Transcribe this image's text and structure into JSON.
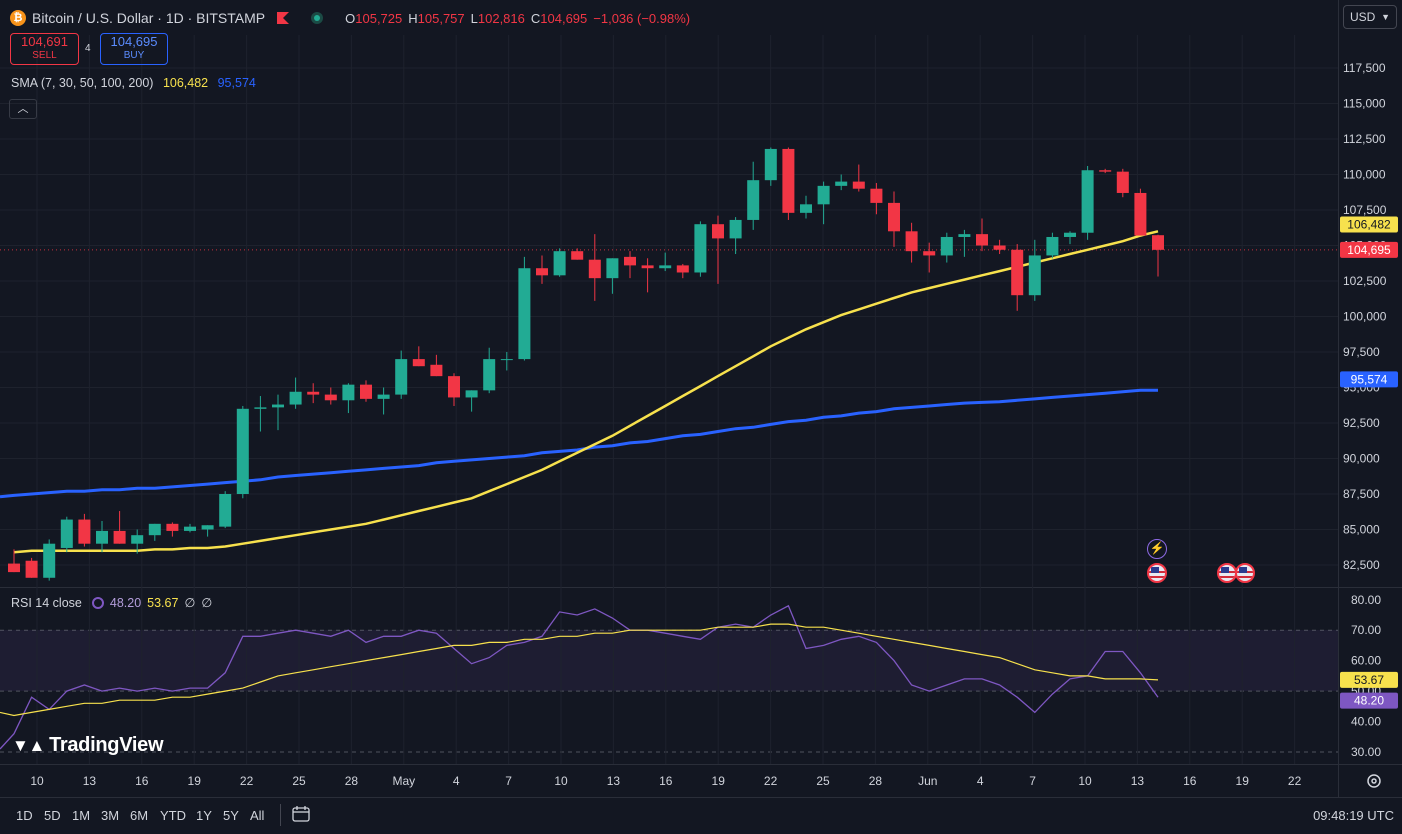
{
  "header": {
    "coin_symbol": "₿",
    "title": "Bitcoin / U.S. Dollar · 1D · BITSTAMP",
    "ohlc": [
      {
        "k": "O",
        "v": "105,725"
      },
      {
        "k": "H",
        "v": "105,757"
      },
      {
        "k": "L",
        "v": "102,816"
      },
      {
        "k": "C",
        "v": "104,695"
      },
      {
        "k": "",
        "v": "−1,036 (−0.98%)"
      }
    ]
  },
  "trade": {
    "sell_price": "104,691",
    "sell_label": "SELL",
    "spread": "4",
    "buy_price": "104,695",
    "buy_label": "BUY"
  },
  "sma": {
    "label": "SMA (7, 30, 50, 100, 200)",
    "v1": "106,482",
    "v2": "95,574"
  },
  "currency": "USD",
  "collapse_icon": "chevron-up-icon",
  "rsi_legend": {
    "label": "RSI 14 close",
    "v1": "48.20",
    "v2": "53.67",
    "v3": "∅",
    "v4": "∅"
  },
  "logo": "TradingView",
  "periods": [
    "1D",
    "5D",
    "1M",
    "3M",
    "6M",
    "YTD",
    "1Y",
    "5Y",
    "All"
  ],
  "clock": "09:48:19 UTC",
  "colors": {
    "up": "#22ab94",
    "down": "#f23645",
    "sma_fast": "#f7e14d",
    "sma_slow": "#2962ff",
    "rsi": "#7e57c2",
    "rsi_ma": "#f7e14d",
    "bg": "#131722"
  },
  "chart_data": [
    {
      "type": "candlestick",
      "x": [
        "Apr 9",
        "Apr 10",
        "Apr 11",
        "Apr 12",
        "Apr 13",
        "Apr 14",
        "Apr 15",
        "Apr 16",
        "Apr 17",
        "Apr 18",
        "Apr 19",
        "Apr 20",
        "Apr 21",
        "Apr 22",
        "Apr 23",
        "Apr 24",
        "Apr 25",
        "Apr 26",
        "Apr 27",
        "Apr 28",
        "Apr 29",
        "Apr 30",
        "May 1",
        "May 2",
        "May 3",
        "May 4",
        "May 5",
        "May 6",
        "May 7",
        "May 8",
        "May 9",
        "May 10",
        "May 11",
        "May 12",
        "May 13",
        "May 14",
        "May 15",
        "May 16",
        "May 17",
        "May 18",
        "May 19",
        "May 20",
        "May 21",
        "May 22",
        "May 23",
        "May 24",
        "May 25",
        "May 26",
        "May 27",
        "May 28",
        "May 29",
        "May 30",
        "May 31",
        "Jun 1",
        "Jun 2",
        "Jun 3",
        "Jun 4",
        "Jun 5",
        "Jun 6",
        "Jun 7",
        "Jun 8",
        "Jun 9",
        "Jun 10",
        "Jun 11",
        "Jun 12",
        "Jun 13"
      ],
      "ohlc": [
        [
          82600,
          83600,
          82000,
          82000
        ],
        [
          82800,
          83000,
          81600,
          81600
        ],
        [
          81600,
          84300,
          81400,
          84000
        ],
        [
          83700,
          85900,
          83400,
          85700
        ],
        [
          85700,
          86100,
          83800,
          84000
        ],
        [
          84000,
          85600,
          83400,
          84900
        ],
        [
          84900,
          86300,
          84000,
          84000
        ],
        [
          84000,
          85000,
          83300,
          84600
        ],
        [
          84600,
          85400,
          84200,
          85400
        ],
        [
          85400,
          85500,
          84500,
          84900
        ],
        [
          84900,
          85400,
          84800,
          85200
        ],
        [
          85000,
          85300,
          84500,
          85300
        ],
        [
          85200,
          87700,
          85100,
          87500
        ],
        [
          87500,
          93700,
          87200,
          93500
        ],
        [
          93500,
          94400,
          91900,
          93600
        ],
        [
          93600,
          94500,
          92000,
          93800
        ],
        [
          93800,
          95700,
          93500,
          94700
        ],
        [
          94700,
          95300,
          93900,
          94500
        ],
        [
          94500,
          95000,
          93800,
          94100
        ],
        [
          94100,
          95300,
          93200,
          95200
        ],
        [
          95200,
          95500,
          94000,
          94200
        ],
        [
          94200,
          95000,
          93100,
          94500
        ],
        [
          94500,
          97600,
          94200,
          97000
        ],
        [
          97000,
          97900,
          96500,
          96500
        ],
        [
          96600,
          97300,
          95800,
          95800
        ],
        [
          95800,
          96000,
          93700,
          94300
        ],
        [
          94300,
          94800,
          93300,
          94800
        ],
        [
          94800,
          97800,
          94600,
          97000
        ],
        [
          97000,
          97500,
          96200,
          97000
        ],
        [
          97000,
          104200,
          96900,
          103400
        ],
        [
          103400,
          104300,
          102300,
          102900
        ],
        [
          102900,
          104800,
          102800,
          104600
        ],
        [
          104600,
          104800,
          104000,
          104000
        ],
        [
          104000,
          105800,
          101100,
          102700
        ],
        [
          102700,
          104100,
          101600,
          104100
        ],
        [
          104200,
          104600,
          102700,
          103600
        ],
        [
          103600,
          104100,
          101700,
          103400
        ],
        [
          103400,
          104500,
          103200,
          103600
        ],
        [
          103600,
          103700,
          102700,
          103100
        ],
        [
          103100,
          106700,
          102800,
          106500
        ],
        [
          106500,
          107100,
          102300,
          105500
        ],
        [
          105500,
          107000,
          104400,
          106800
        ],
        [
          106800,
          110900,
          106100,
          109600
        ],
        [
          109600,
          111900,
          109200,
          111800
        ],
        [
          111800,
          111900,
          106800,
          107300
        ],
        [
          107300,
          108500,
          106900,
          107900
        ],
        [
          107900,
          109500,
          106500,
          109200
        ],
        [
          109200,
          110000,
          108900,
          109500
        ],
        [
          109500,
          110700,
          108800,
          109000
        ],
        [
          109000,
          109400,
          107200,
          108000
        ],
        [
          108000,
          108800,
          104900,
          106000
        ],
        [
          106000,
          106600,
          103800,
          104600
        ],
        [
          104600,
          105200,
          103100,
          104300
        ],
        [
          104300,
          105900,
          103800,
          105600
        ],
        [
          105600,
          106100,
          104200,
          105800
        ],
        [
          105800,
          106900,
          104600,
          105000
        ],
        [
          105000,
          105400,
          104400,
          104700
        ],
        [
          104700,
          105100,
          100400,
          101500
        ],
        [
          101500,
          105400,
          101100,
          104300
        ],
        [
          104300,
          105900,
          104100,
          105600
        ],
        [
          105600,
          106000,
          105100,
          105900
        ],
        [
          105900,
          110600,
          105400,
          110300
        ],
        [
          110300,
          110400,
          110100,
          110200
        ],
        [
          110200,
          110400,
          108400,
          108700
        ],
        [
          108700,
          109000,
          105800,
          105700
        ],
        [
          105725,
          105757,
          102816,
          104695
        ]
      ],
      "sma_fast_values": [
        83400,
        83500,
        83500,
        83500,
        83500,
        83500,
        83500,
        83500,
        83600,
        83600,
        83700,
        83700,
        83800,
        84000,
        84200,
        84400,
        84600,
        84800,
        85000,
        85200,
        85400,
        85700,
        86000,
        86300,
        86600,
        86900,
        87200,
        87700,
        88200,
        88700,
        89200,
        89800,
        90400,
        91000,
        91600,
        92300,
        93000,
        93700,
        94400,
        95100,
        95800,
        96500,
        97200,
        97900,
        98500,
        99100,
        99600,
        100100,
        100500,
        100900,
        101300,
        101700,
        102000,
        102300,
        102600,
        102900,
        103200,
        103500,
        103800,
        104100,
        104400,
        104700,
        105000,
        105300,
        105700,
        106000
      ],
      "sma_slow_values": [
        87400,
        87500,
        87600,
        87700,
        87700,
        87800,
        87800,
        87900,
        87900,
        88000,
        88100,
        88200,
        88300,
        88400,
        88500,
        88700,
        88800,
        88900,
        89000,
        89100,
        89200,
        89300,
        89400,
        89500,
        89700,
        89800,
        89900,
        90000,
        90100,
        90200,
        90400,
        90500,
        90600,
        90800,
        90900,
        91100,
        91200,
        91400,
        91600,
        91700,
        91900,
        92100,
        92200,
        92400,
        92600,
        92700,
        92900,
        93000,
        93200,
        93300,
        93500,
        93600,
        93700,
        93800,
        93900,
        93950,
        94000,
        94100,
        94200,
        94300,
        94400,
        94500,
        94600,
        94700,
        94800,
        94800
      ],
      "price_labels": {
        "sma_fast": "106,482",
        "last": "104,695",
        "sma_slow": "95,574"
      },
      "x_ticks": [
        "10",
        "13",
        "16",
        "19",
        "22",
        "25",
        "28",
        "May",
        "4",
        "7",
        "10",
        "13",
        "16",
        "19",
        "22",
        "25",
        "28",
        "Jun",
        "4",
        "7",
        "10",
        "13",
        "16",
        "19",
        "22"
      ],
      "y_ticks": [
        "117,500",
        "115,000",
        "112,500",
        "110,000",
        "107,500",
        "105,000",
        "102,500",
        "100,000",
        "97,500",
        "95,000",
        "92,500",
        "90,000",
        "87,500",
        "85,000",
        "82,500"
      ],
      "ylim": [
        80000,
        120000
      ]
    },
    {
      "type": "line",
      "name": "RSI 14 close",
      "rsi_values": [
        36,
        48,
        44,
        50,
        52,
        50,
        51,
        50,
        51,
        50,
        51,
        51,
        56,
        68,
        68,
        69,
        70,
        69,
        68,
        70,
        66,
        68,
        68,
        70,
        69,
        64,
        59,
        61,
        65,
        66,
        68,
        76,
        75,
        77,
        74,
        70,
        70,
        69,
        68,
        67,
        71,
        72,
        71,
        75,
        78,
        64,
        65,
        67,
        68,
        66,
        60,
        52,
        50,
        52,
        54,
        54,
        52,
        48,
        43,
        49,
        54,
        55,
        63,
        63,
        56,
        48
      ],
      "rsi_ma_values": [
        42,
        43,
        44,
        45,
        46,
        46,
        47,
        47,
        47,
        48,
        48,
        49,
        50,
        51,
        53,
        55,
        56,
        57,
        58,
        59,
        60,
        61,
        62,
        63,
        64,
        65,
        65,
        66,
        66,
        67,
        67,
        68,
        68,
        69,
        69,
        70,
        70,
        70,
        70,
        70,
        71,
        71,
        71,
        72,
        72,
        71,
        71,
        70,
        69,
        68,
        67,
        66,
        65,
        64,
        63,
        62,
        61,
        59,
        57,
        56,
        55,
        55,
        54,
        54,
        54,
        53.67
      ],
      "labels": {
        "rsi": "48.20",
        "ma": "53.67"
      },
      "y_ticks": [
        "80.00",
        "70.00",
        "60.00",
        "50.00",
        "40.00",
        "30.00"
      ],
      "ylim": [
        26,
        82
      ]
    }
  ]
}
